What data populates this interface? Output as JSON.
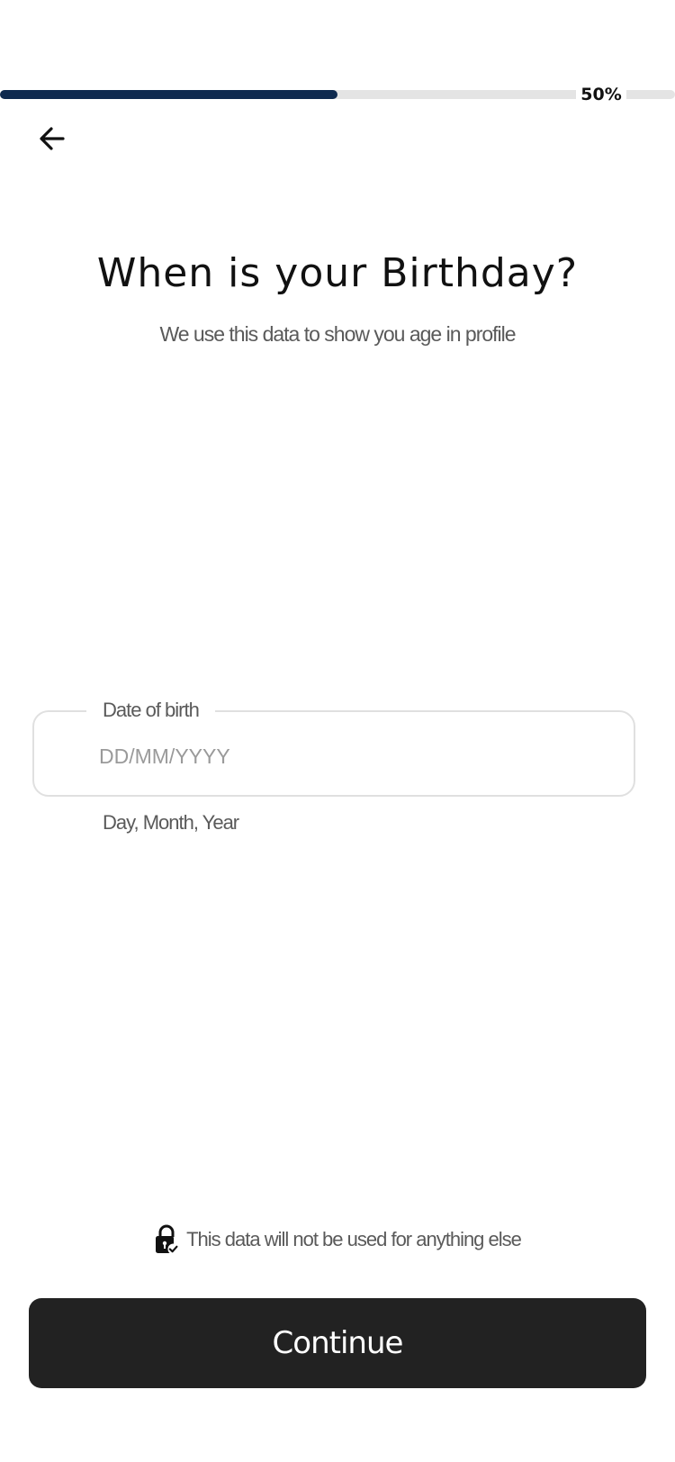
{
  "progress": {
    "value": 0.5,
    "label": "50%",
    "fill_color": "#0f2a4f",
    "track_color": "#e4e4e4"
  },
  "header": {
    "back_icon": "arrow-left-icon"
  },
  "main": {
    "title": "When is your Birthday?",
    "subtitle": "We use this data to show you age in profile"
  },
  "dob": {
    "label": "Date of birth",
    "value": "",
    "placeholder": "DD/MM/YYYY",
    "helper": "Day, Month, Year"
  },
  "privacy": {
    "icon": "lock-check-icon",
    "text": "This data will not be used for anything else"
  },
  "footer": {
    "continue_label": "Continue",
    "button_color": "#222222"
  }
}
